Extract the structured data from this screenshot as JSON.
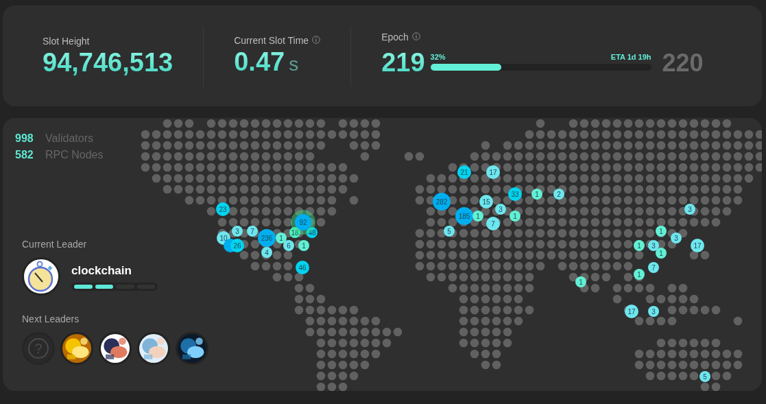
{
  "stats": [
    {
      "kind": "slot_height",
      "label": "Slot Height",
      "value": "94,746,513"
    },
    {
      "kind": "slot_time",
      "label": "Current Slot Time",
      "info": true,
      "value": "0.47",
      "unit": "s"
    },
    {
      "kind": "epoch",
      "label": "Epoch",
      "info": true,
      "value": "219",
      "percent": "32%",
      "level": 0.32,
      "eta": "ETA 1d 19h",
      "next": "220"
    }
  ],
  "network": [
    {
      "count": "998",
      "label": "Validators"
    },
    {
      "count": "582",
      "label": "RPC Nodes"
    }
  ],
  "current_leader": {
    "title": "Current Leader",
    "name": "clockchain",
    "slots": [
      {
        "filled": true
      },
      {
        "filled": true
      },
      {
        "filled": false
      },
      {
        "filled": false
      }
    ]
  },
  "next_leaders": {
    "title": "Next Leaders",
    "items": [
      {
        "kind": "unknown",
        "label": "?"
      },
      {
        "kind": "picture"
      },
      {
        "kind": "picture"
      },
      {
        "kind": "picture"
      },
      {
        "kind": "picture"
      }
    ]
  },
  "clusters": [
    {
      "label": "23",
      "color": "#00d4f0",
      "kind": "medium"
    },
    {
      "label": "10",
      "color": "#6ee6ee",
      "kind": "medium"
    },
    {
      "color": "#00aef0",
      "kind": "medium"
    },
    {
      "label": "26",
      "color": "#00d4f0",
      "kind": "medium"
    },
    {
      "label": "3",
      "color": "#6ee6ee",
      "kind": "small"
    },
    {
      "label": "7",
      "color": "#6ee6ee",
      "kind": "small"
    },
    {
      "label": "236",
      "color": "#00aef0",
      "kind": "large"
    },
    {
      "label": "1",
      "color": "#62f0d4",
      "kind": "small"
    },
    {
      "label": "6",
      "color": "#6ee6ee",
      "kind": "small"
    },
    {
      "label": "1",
      "color": "#62f0d4",
      "kind": "small"
    },
    {
      "label": "4",
      "color": "#6ee6ee",
      "kind": "small"
    },
    {
      "label": "18",
      "color": "#4ef0c0",
      "kind": "small"
    },
    {
      "label": "48",
      "color": "#00d4f0",
      "kind": "small"
    },
    {
      "label": "92",
      "color": "#00aef0",
      "kind": "glow"
    },
    {
      "label": "46",
      "color": "#00d4f0",
      "kind": "medium"
    },
    {
      "label": "21",
      "color": "#00d4f0",
      "kind": "medium"
    },
    {
      "label": "17",
      "color": "#6ee6ee",
      "kind": "medium"
    },
    {
      "label": "33",
      "color": "#00d4f0",
      "kind": "medium"
    },
    {
      "label": "1",
      "color": "#62f0d4",
      "kind": "small"
    },
    {
      "label": "2",
      "color": "#6ee6ee",
      "kind": "small"
    },
    {
      "label": "282",
      "color": "#00aef0",
      "kind": "large"
    },
    {
      "label": "15",
      "color": "#6ee6ee",
      "kind": "medium"
    },
    {
      "label": "3",
      "color": "#6ee6ee",
      "kind": "small"
    },
    {
      "label": "185",
      "color": "#00aef0",
      "kind": "large"
    },
    {
      "label": "1",
      "color": "#62f0d4",
      "kind": "small"
    },
    {
      "label": "1",
      "color": "#62f0d4",
      "kind": "small"
    },
    {
      "label": "7",
      "color": "#6ee6ee",
      "kind": "medium"
    },
    {
      "label": "5",
      "color": "#6ee6ee",
      "kind": "small"
    },
    {
      "label": "3",
      "color": "#6ee6ee",
      "kind": "small"
    },
    {
      "label": "1",
      "color": "#62f0d4",
      "kind": "small"
    },
    {
      "label": "3",
      "color": "#6ee6ee",
      "kind": "small"
    },
    {
      "label": "1",
      "color": "#62f0d4",
      "kind": "small"
    },
    {
      "label": "3",
      "color": "#6ee6ee",
      "kind": "small"
    },
    {
      "label": "17",
      "color": "#6ee6ee",
      "kind": "medium"
    },
    {
      "label": "1",
      "color": "#62f0d4",
      "kind": "small"
    },
    {
      "label": "7",
      "color": "#6ee6ee",
      "kind": "small"
    },
    {
      "label": "1",
      "color": "#62f0d4",
      "kind": "small"
    },
    {
      "label": "1",
      "color": "#62f0d4",
      "kind": "small"
    },
    {
      "label": "17",
      "color": "#6ee6ee",
      "kind": "medium"
    },
    {
      "label": "3",
      "color": "#6ee6ee",
      "kind": "small"
    },
    {
      "label": "5",
      "color": "#6ee6ee",
      "kind": "small"
    }
  ]
}
